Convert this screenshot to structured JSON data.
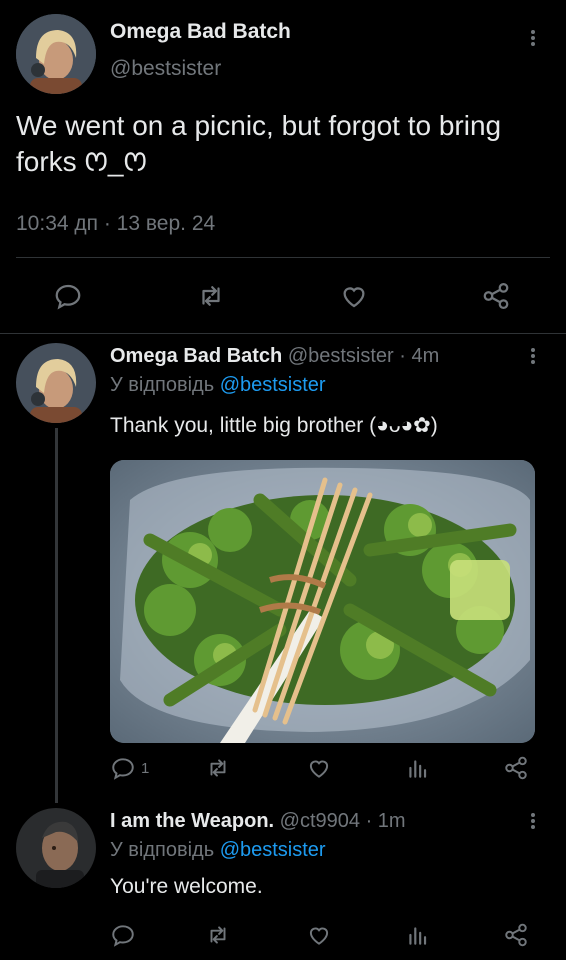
{
  "main_tweet": {
    "author_name": "Omega Bad Batch",
    "author_handle": "@bestsister",
    "text": "We went on a picnic, but forgot to bring forks ꯁ_ꯁ",
    "text_line1": "We went on a picnic, but forgot to bring",
    "text_line2": "forks ꯁ_ꯁ",
    "timestamp": "10:34 дп · 13 вер. 24",
    "actions": [
      "reply-icon",
      "retweet-icon",
      "like-icon",
      "share-icon"
    ]
  },
  "replies": [
    {
      "author_name": "Omega Bad Batch",
      "author_handle": "@bestsister",
      "time": "· 4m",
      "reply_prefix": "У відповідь",
      "reply_to": "@bestsister",
      "text": "Thank you, little big brother (◕ᴗ◕✿)",
      "image_alt": "Container of broccoli and green beans with a fork made of toothpicks tied with rubber bands",
      "reply_count": "1"
    },
    {
      "author_name": "I am the Weapon.",
      "author_handle": "@ct9904",
      "time": "· 1m",
      "reply_prefix": "У відповідь",
      "reply_to": "@bestsister",
      "text": "You're welcome."
    }
  ],
  "colors": {
    "background": "#000000",
    "text": "#e7e9ea",
    "muted": "#71767b",
    "link": "#1d9bf0",
    "divider": "#2f3336"
  }
}
